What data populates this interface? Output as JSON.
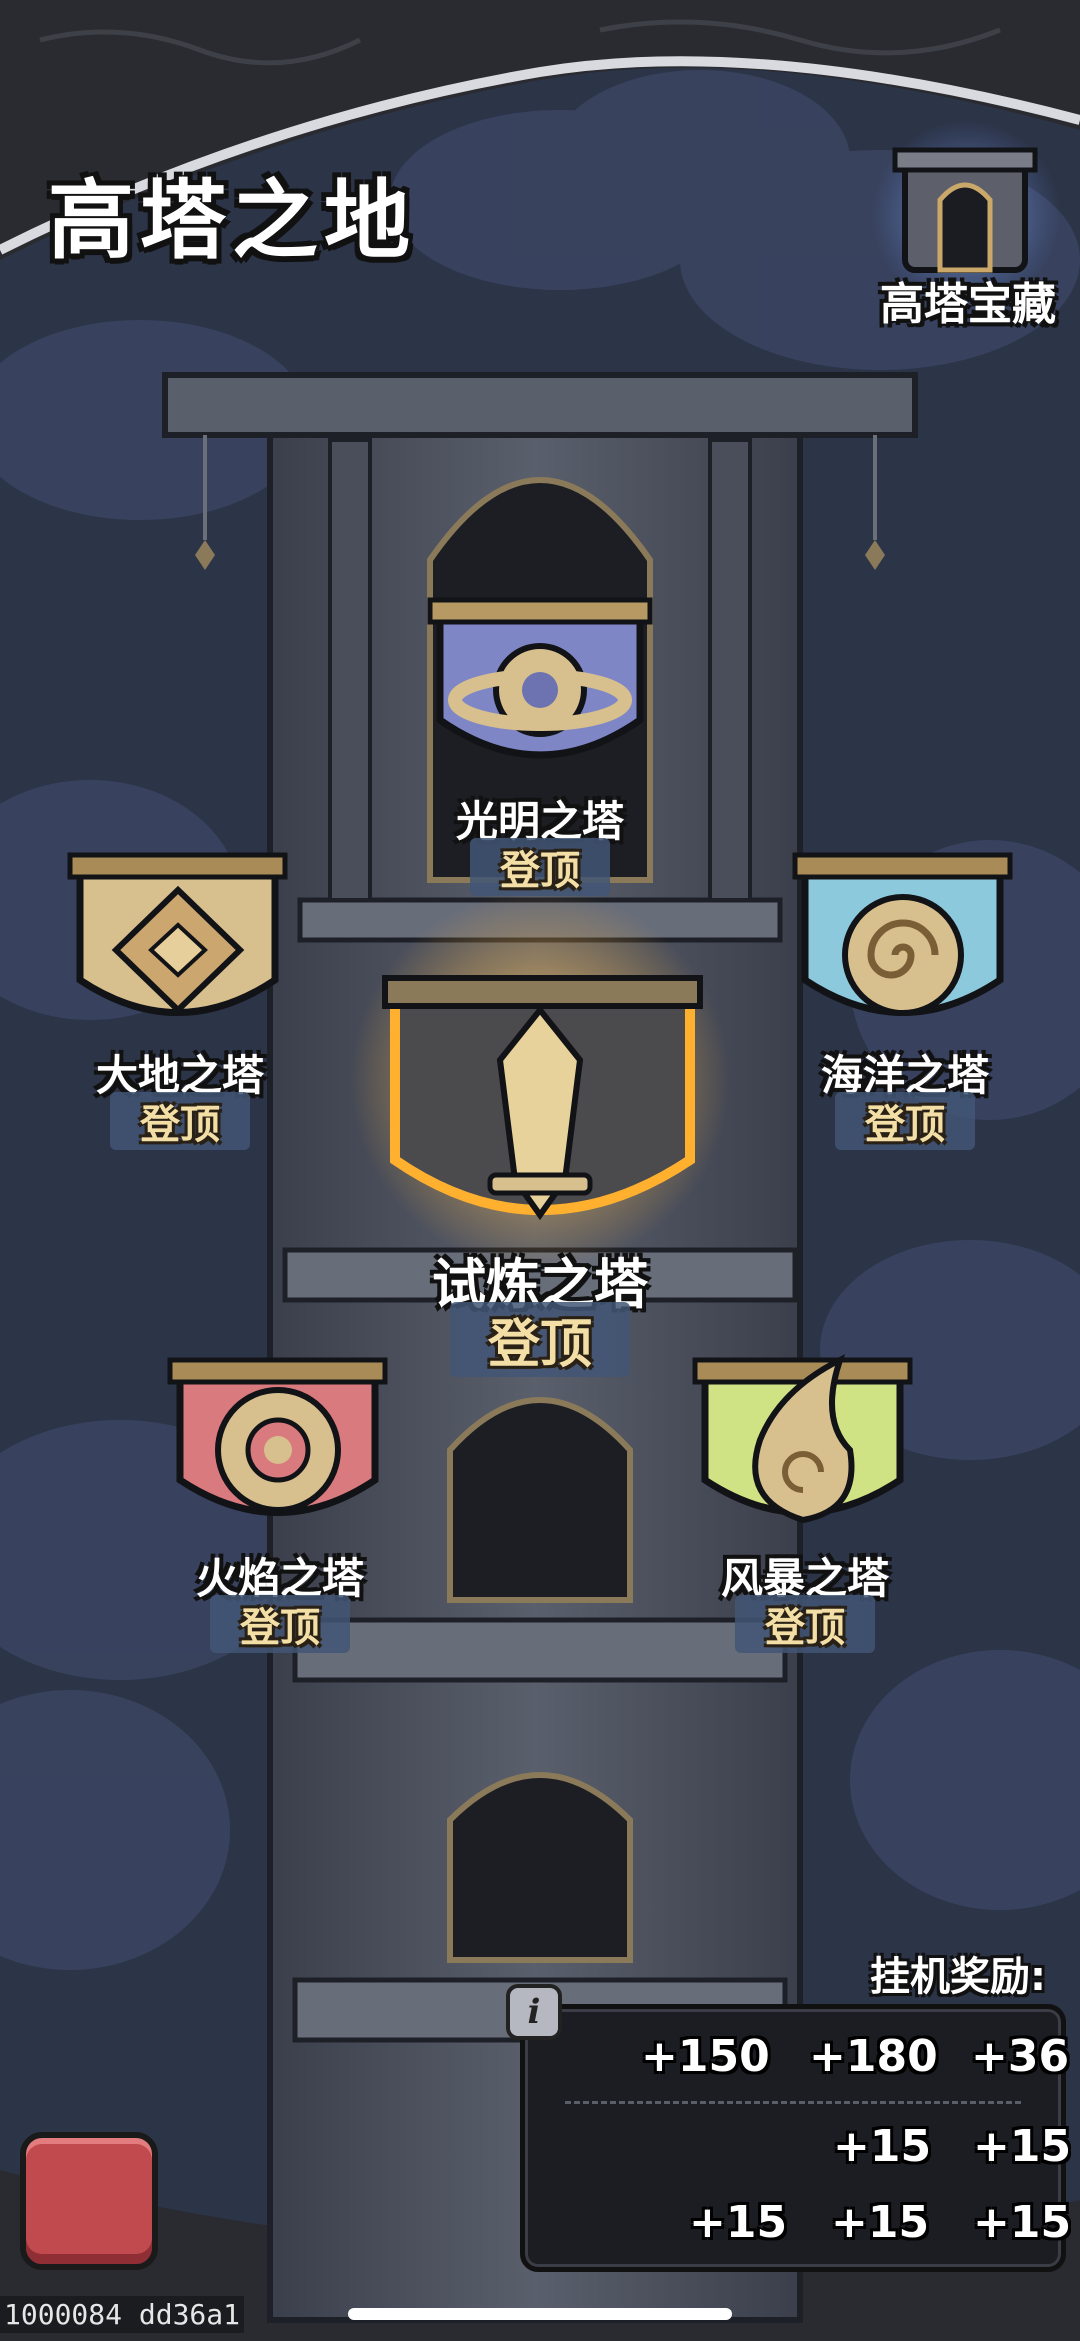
{
  "header": {
    "title": "高塔之地"
  },
  "treasure": {
    "label": "高塔宝藏"
  },
  "towers": [
    {
      "name": "光明之塔",
      "action": "登顶"
    },
    {
      "name": "大地之塔",
      "action": "登顶"
    },
    {
      "name": "海洋之塔",
      "action": "登顶"
    },
    {
      "name": "试炼之塔",
      "action": "登顶"
    },
    {
      "name": "火焰之塔",
      "action": "登顶"
    },
    {
      "name": "风暴之塔",
      "action": "登顶"
    }
  ],
  "idle_rewards": {
    "title": "挂机奖励:",
    "row1": [
      "+150",
      "+180",
      "+36"
    ],
    "row2": [
      "+15",
      "+15"
    ],
    "row3": [
      "+15",
      "+15",
      "+15"
    ]
  },
  "footer": {
    "build_id": "1000084 dd36a1"
  },
  "colors": {
    "sky": "#2b3346",
    "tower_stone": "#4d5260",
    "light_banner": "#7e86c6",
    "earth_banner": "#d7bf8e",
    "ocean_banner": "#8cc9dc",
    "trial_banner": "#4b4b4e",
    "fire_banner": "#d97a7f",
    "storm_banner": "#cfe284",
    "back_button": "#c14a4f"
  }
}
